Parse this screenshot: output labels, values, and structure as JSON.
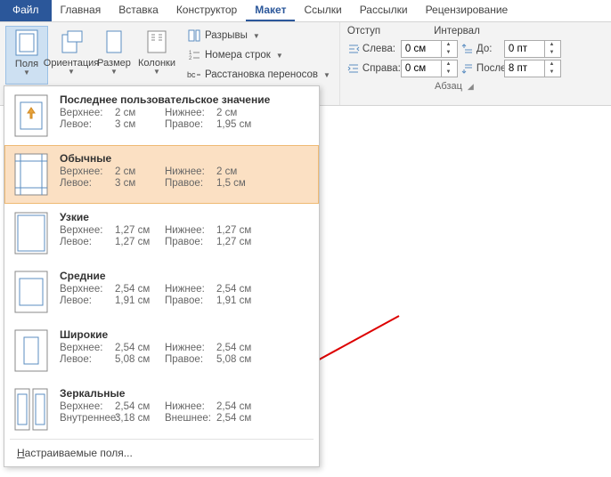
{
  "tabs": {
    "file": "Файл",
    "home": "Главная",
    "insert": "Вставка",
    "design": "Конструктор",
    "layout": "Макет",
    "references": "Ссылки",
    "mailings": "Рассылки",
    "review": "Рецензирование"
  },
  "ribbon": {
    "margins": "Поля",
    "orientation": "Ориентация",
    "size": "Размер",
    "columns": "Колонки",
    "breaks": "Разрывы",
    "line_numbers": "Номера строк",
    "hyphenation": "Расстановка переносов"
  },
  "indent": {
    "indent_label": "Отступ",
    "spacing_label": "Интервал",
    "left": "Слева:",
    "right": "Справа:",
    "before": "До:",
    "after": "После:",
    "left_val": "0 см",
    "right_val": "0 см",
    "before_val": "0 пт",
    "after_val": "8 пт",
    "group_name": "Абзац"
  },
  "margins_menu": {
    "items": [
      {
        "title": "Последнее пользовательское значение",
        "top_lbl": "Верхнее:",
        "top_val": "2 см",
        "bottom_lbl": "Нижнее:",
        "bottom_val": "2 см",
        "left_lbl": "Левое:",
        "left_val": "3 см",
        "right_lbl": "Правое:",
        "right_val": "1,95 см"
      },
      {
        "title": "Обычные",
        "top_lbl": "Верхнее:",
        "top_val": "2 см",
        "bottom_lbl": "Нижнее:",
        "bottom_val": "2 см",
        "left_lbl": "Левое:",
        "left_val": "3 см",
        "right_lbl": "Правое:",
        "right_val": "1,5 см"
      },
      {
        "title": "Узкие",
        "top_lbl": "Верхнее:",
        "top_val": "1,27 см",
        "bottom_lbl": "Нижнее:",
        "bottom_val": "1,27 см",
        "left_lbl": "Левое:",
        "left_val": "1,27 см",
        "right_lbl": "Правое:",
        "right_val": "1,27 см"
      },
      {
        "title": "Средние",
        "top_lbl": "Верхнее:",
        "top_val": "2,54 см",
        "bottom_lbl": "Нижнее:",
        "bottom_val": "2,54 см",
        "left_lbl": "Левое:",
        "left_val": "1,91 см",
        "right_lbl": "Правое:",
        "right_val": "1,91 см"
      },
      {
        "title": "Широкие",
        "top_lbl": "Верхнее:",
        "top_val": "2,54 см",
        "bottom_lbl": "Нижнее:",
        "bottom_val": "2,54 см",
        "left_lbl": "Левое:",
        "left_val": "5,08 см",
        "right_lbl": "Правое:",
        "right_val": "5,08 см"
      },
      {
        "title": "Зеркальные",
        "top_lbl": "Верхнее:",
        "top_val": "2,54 см",
        "bottom_lbl": "Нижнее:",
        "bottom_val": "2,54 см",
        "left_lbl": "Внутреннее:",
        "left_val": "3,18 см",
        "right_lbl": "Внешнее:",
        "right_val": "2,54 см"
      }
    ],
    "custom": "Настраиваемые поля..."
  }
}
